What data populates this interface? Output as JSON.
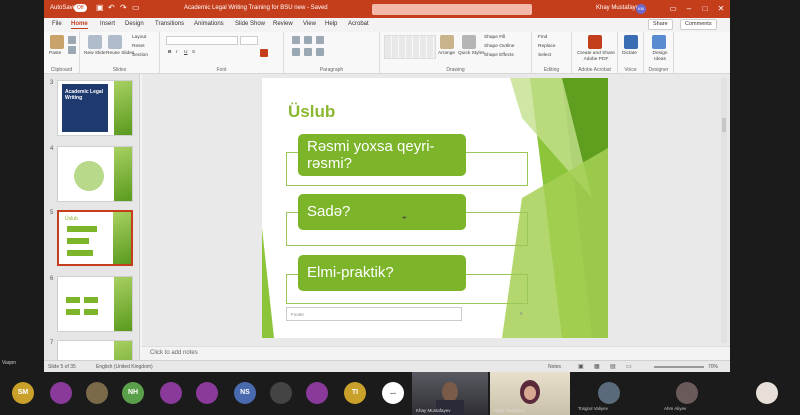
{
  "app": {
    "autosave": "AutoSave",
    "toggle": "Off",
    "doc_title": "Academic Legal Writing Training for BSU new - Saved",
    "user": "Khay Mustafayev",
    "user_initials": "KM",
    "accent": "#c43e1c"
  },
  "tabs": [
    "File",
    "Home",
    "Insert",
    "Design",
    "Transitions",
    "Animations",
    "Slide Show",
    "Review",
    "View",
    "Help",
    "Acrobat"
  ],
  "tab_buttons": {
    "share": "Share",
    "comments": "Comments"
  },
  "ribbon": {
    "clipboard": {
      "label": "Clipboard",
      "paste": "Paste"
    },
    "slides": {
      "label": "Slides",
      "new_slide": "New Slide",
      "reuse": "Reuse Slides",
      "layout": "Layout",
      "reset": "Reset",
      "section": "Section"
    },
    "font": {
      "label": "Font"
    },
    "paragraph": {
      "label": "Paragraph"
    },
    "drawing": {
      "label": "Drawing",
      "arrange": "Arrange",
      "quick_styles": "Quick Styles",
      "shape_fill": "Shape Fill",
      "shape_outline": "Shape Outline",
      "shape_effects": "Shape Effects"
    },
    "editing": {
      "label": "Editing",
      "find": "Find",
      "replace": "Replace",
      "select": "Select"
    },
    "acrobat": {
      "label": "Adobe Acrobat",
      "create": "Create and Share Adobe PDF"
    },
    "voice": {
      "label": "Voice",
      "dictate": "Dictate"
    },
    "designer": {
      "label": "Designer",
      "design_ideas": "Design Ideas"
    }
  },
  "thumbnails": [
    {
      "num": "3",
      "caption": "Academic Legal Writing"
    },
    {
      "num": "4",
      "caption": ""
    },
    {
      "num": "5",
      "caption": "Üslub"
    },
    {
      "num": "6",
      "caption": ""
    },
    {
      "num": "7",
      "caption": ""
    }
  ],
  "slide": {
    "title": "Üslub",
    "items": [
      "Rəsmi yoxsa qeyri-rəsmi?",
      "Sadə?",
      "Elmi-praktik?"
    ],
    "footer": "Footer",
    "page_number": "5",
    "green": "#7cb42a"
  },
  "notes_placeholder": "Click to add notes",
  "status": {
    "slide_count": "Slide 5 of 35",
    "language": "English (United Kingdom)",
    "notes": "Notes",
    "zoom": "70%"
  },
  "meeting": {
    "participants": [
      {
        "initials": "SM",
        "color": "#c8a02a"
      },
      {
        "initials": "",
        "color": "#8a3a9a"
      },
      {
        "initials": "",
        "color": "#7a6a4a"
      },
      {
        "initials": "NH",
        "color": "#5aa04a"
      },
      {
        "initials": "",
        "color": "#8a3a9a"
      },
      {
        "initials": "",
        "color": "#8a3a9a"
      },
      {
        "initials": "NS",
        "color": "#4a6ab0"
      },
      {
        "initials": "",
        "color": "#444444"
      },
      {
        "initials": "",
        "color": "#8a3a9a"
      },
      {
        "initials": "TI",
        "color": "#c8a02a"
      },
      {
        "initials": "...",
        "color": "#ffffff"
      }
    ],
    "videos": [
      {
        "name": "Khay Mustafayev"
      },
      {
        "name": "Nigar Namazov"
      }
    ],
    "named_avatars": [
      {
        "name": "Tosgrul Valiyev"
      },
      {
        "name": "Ahm Aliyev"
      }
    ],
    "side_label": "Vaqon"
  }
}
